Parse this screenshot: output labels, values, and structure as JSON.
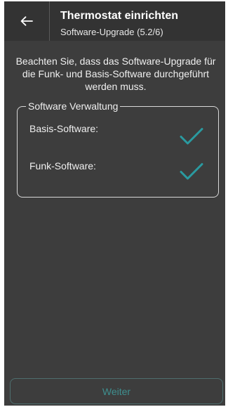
{
  "header": {
    "title": "Thermostat einrichten",
    "subtitle": "Software-Upgrade (5.2/6)",
    "back_icon": "arrow-left-icon"
  },
  "intro": {
    "text": "Beachten Sie, dass das Software-Upgrade für die Funk- und Basis-Software durchgeführt werden muss."
  },
  "software_group": {
    "legend": "Software Verwaltung",
    "items": [
      {
        "label": "Basis-Software:",
        "status_icon": "checkmark-icon"
      },
      {
        "label": "Funk-Software:",
        "status_icon": "checkmark-icon"
      }
    ]
  },
  "footer": {
    "next_label": "Weiter"
  },
  "colors": {
    "background": "#3d3d3d",
    "header": "#333333",
    "accent": "#2a9aa0",
    "button_text_disabled": "#3e8f8f"
  }
}
